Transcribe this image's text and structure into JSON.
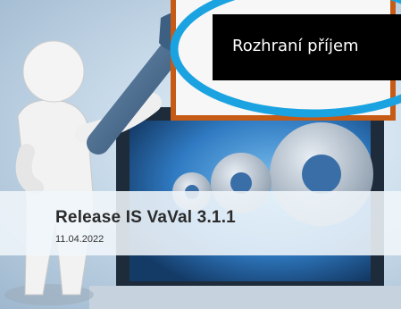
{
  "release": {
    "title": "Release IS VaVal 3.1.1",
    "date": "11.04.2022"
  },
  "callout": {
    "text": "Rozhraní příjem",
    "border_color": "#c65b16",
    "highlight_color": "#1aa3e0"
  },
  "illustration": {
    "figure": "person-holding-wrench-icon",
    "background": "monitor-with-gears-icon"
  }
}
